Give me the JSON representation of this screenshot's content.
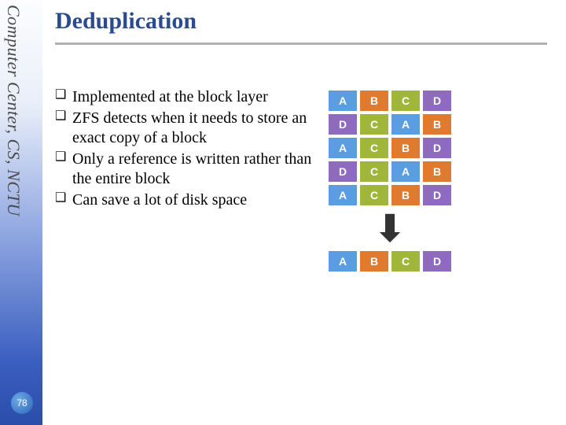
{
  "sidebar": {
    "org": "Computer Center, CS, NCTU"
  },
  "pageNumber": "78",
  "title": "Deduplication",
  "bullets": [
    "Implemented at the block layer",
    "ZFS detects when it needs to store an exact copy of a block",
    "Only a reference is written rather than the entire block",
    "Can save a lot of disk space"
  ],
  "diagram": {
    "topRows": [
      [
        "A",
        "B",
        "C",
        "D"
      ],
      [
        "D",
        "C",
        "A",
        "B"
      ],
      [
        "A",
        "C",
        "B",
        "D"
      ],
      [
        "D",
        "C",
        "A",
        "B"
      ],
      [
        "A",
        "C",
        "B",
        "D"
      ]
    ],
    "arrow": "⬇",
    "bottomRows": [
      [
        "A",
        "B",
        "C",
        "D"
      ]
    ],
    "colors": {
      "A": "cA",
      "B": "cB",
      "C": "cC",
      "D": "cD"
    }
  }
}
